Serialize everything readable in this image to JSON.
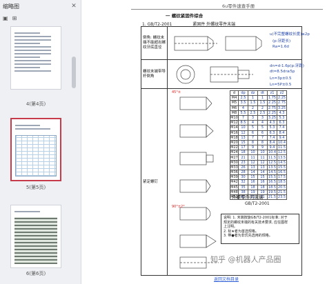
{
  "sidebar": {
    "title": "缩略图",
    "close_icon": "close-icon",
    "tools": [
      "▣",
      "⊞"
    ],
    "pages": [
      {
        "label": "4(第4页)"
      },
      {
        "label": "5(第5页)"
      },
      {
        "label": "6(第6页)"
      }
    ]
  },
  "doc": {
    "running_header": "6u零件速查手册",
    "section_title": "一  螺纹紧固件综合",
    "std_number": "1. GB/T2-2001",
    "std_name": "紧固件  外螺纹零件末端",
    "row_labels": [
      "倒角: 螺纹末端不能超出螺纹牙底直径",
      "螺纹末端带导杆倒角",
      "长圆柱端",
      "紧定螺钉"
    ],
    "formula_lines": [
      "u(不完整螺纹长度)≤2p",
      "(p:牙距长)",
      "Ra=1.6d",
      "dn=d-1.6p(p:牙距)",
      "dt=8.5dr≥5p",
      "Ln=3p±0.5",
      "Ln=5P±0.5"
    ],
    "table_header": [
      "d",
      "dp",
      "dz",
      "dt",
      "z1",
      "z2"
    ],
    "table_rows": [
      [
        "M4",
        "2.5",
        "1",
        "1",
        "1.75",
        "2.25"
      ],
      [
        "M5",
        "3.5",
        "1.5",
        "1.5",
        "2.25",
        "2.75"
      ],
      [
        "M6",
        "4",
        "2",
        "2",
        "2.75",
        "3.25"
      ],
      [
        "M8",
        "5.5",
        "2.5",
        "2.5",
        "2.25",
        "4.3"
      ],
      [
        "M10",
        "7",
        "3",
        "3",
        "3.25",
        "5.3"
      ],
      [
        "M12",
        "8.5",
        "4",
        "4",
        "4.3",
        "6.3"
      ],
      [
        "M14",
        "10",
        "5",
        "5",
        "5.3",
        "7.4"
      ],
      [
        "M16",
        "12",
        "6",
        "6",
        "6.3",
        "8.4"
      ],
      [
        "M18",
        "13",
        "7",
        "7",
        "7.4",
        "9.4"
      ],
      [
        "M20",
        "15",
        "8",
        "8",
        "8.4",
        "10.4"
      ],
      [
        "M22",
        "17",
        "9",
        "9",
        "9.4",
        "11.5"
      ],
      [
        "M24",
        "18",
        "10",
        "10",
        "10.4",
        "12.5"
      ],
      [
        "M27",
        "21",
        "11",
        "11",
        "11.5",
        "13.5"
      ],
      [
        "M30",
        "23",
        "12",
        "12",
        "12.5",
        "14.5"
      ],
      [
        "M33",
        "26",
        "13",
        "13",
        "13.5",
        "15.5"
      ],
      [
        "M36",
        "28",
        "14",
        "14",
        "14.5",
        "16.5"
      ],
      [
        "M39",
        "30",
        "15",
        "15",
        "15.5",
        "17.5"
      ],
      [
        "M42",
        "32",
        "16",
        "16",
        "16.5",
        "18.5"
      ],
      [
        "M45",
        "35",
        "18",
        "18",
        "18.5",
        "20.5"
      ],
      [
        "M48",
        "38",
        "19",
        "19",
        "19.5",
        "21.5"
      ],
      [
        "M52",
        "42",
        "21",
        "21",
        "21.5",
        "23.5"
      ]
    ],
    "ends_title": "外螺零件的末端",
    "ends_std": "GB/T2-2001",
    "notes": "说明: 1. 末端按旋GB/T2-2001标准; 对于\n  规定的螺纹末端的有关技术要求, 应在图样\n  上注明。\n2. 标★者为首选规格。\n3. 带●者为非优先选用的规格。",
    "watermark": "知乎 @机器人产品圈",
    "footer_link": "返回文档目录"
  }
}
